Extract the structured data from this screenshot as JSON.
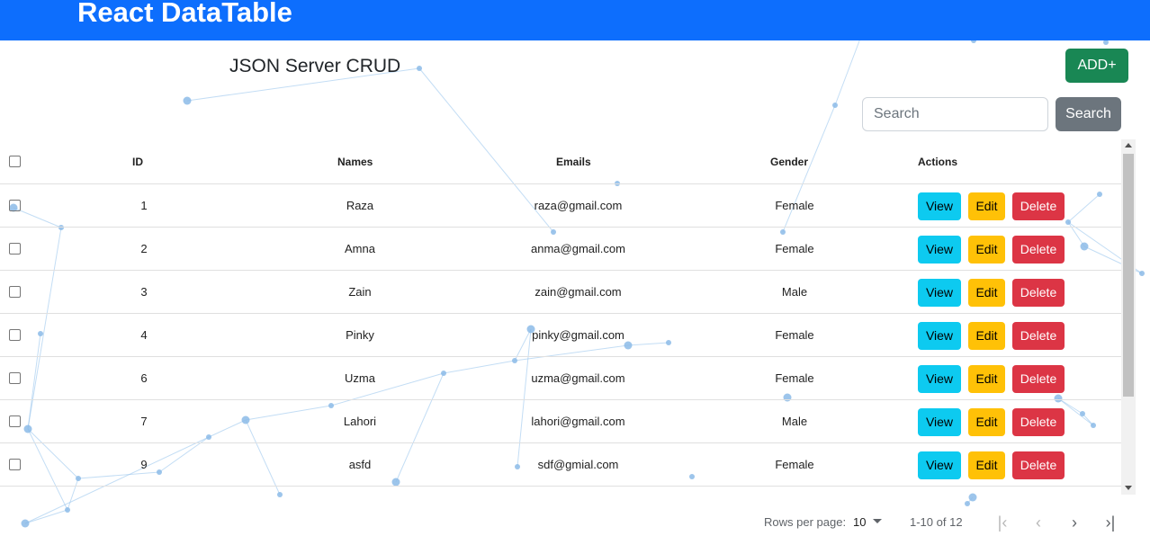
{
  "header": {
    "title": "React DataTable"
  },
  "page": {
    "subtitle": "JSON Server CRUD",
    "add_label": "ADD+"
  },
  "search": {
    "placeholder": "Search",
    "button_label": "Search"
  },
  "table": {
    "columns": [
      "ID",
      "Names",
      "Emails",
      "Gender",
      "Actions"
    ],
    "rows": [
      {
        "id": "1",
        "name": "Raza",
        "email": "raza@gmail.com",
        "gender": "Female"
      },
      {
        "id": "2",
        "name": "Amna",
        "email": "anma@gmail.com",
        "gender": "Female"
      },
      {
        "id": "3",
        "name": "Zain",
        "email": "zain@gmail.com",
        "gender": "Male"
      },
      {
        "id": "4",
        "name": "Pinky",
        "email": "pinky@gmail.com",
        "gender": "Female"
      },
      {
        "id": "6",
        "name": "Uzma",
        "email": "uzma@gmail.com",
        "gender": "Female"
      },
      {
        "id": "7",
        "name": "Lahori",
        "email": "lahori@gmail.com",
        "gender": "Male"
      },
      {
        "id": "9",
        "name": "asfd",
        "email": "sdf@gmial.com",
        "gender": "Female"
      }
    ],
    "actions": {
      "view": "View",
      "edit": "Edit",
      "delete": "Delete"
    }
  },
  "pagination": {
    "rows_per_page_label": "Rows per page:",
    "rows_per_page": "10",
    "range": "1-10 of 12"
  },
  "icons": {
    "first_page": "first-page-icon",
    "prev_page": "chevron-left-icon",
    "next_page": "chevron-right-icon",
    "last_page": "last-page-icon",
    "select_caret": "caret-down-icon"
  },
  "colors": {
    "header_bg": "#0d6efd",
    "add_button": "#198754",
    "search_button": "#6c757d",
    "view_button": "#0dcaf0",
    "edit_button": "#ffc107",
    "delete_button": "#dc3545"
  }
}
